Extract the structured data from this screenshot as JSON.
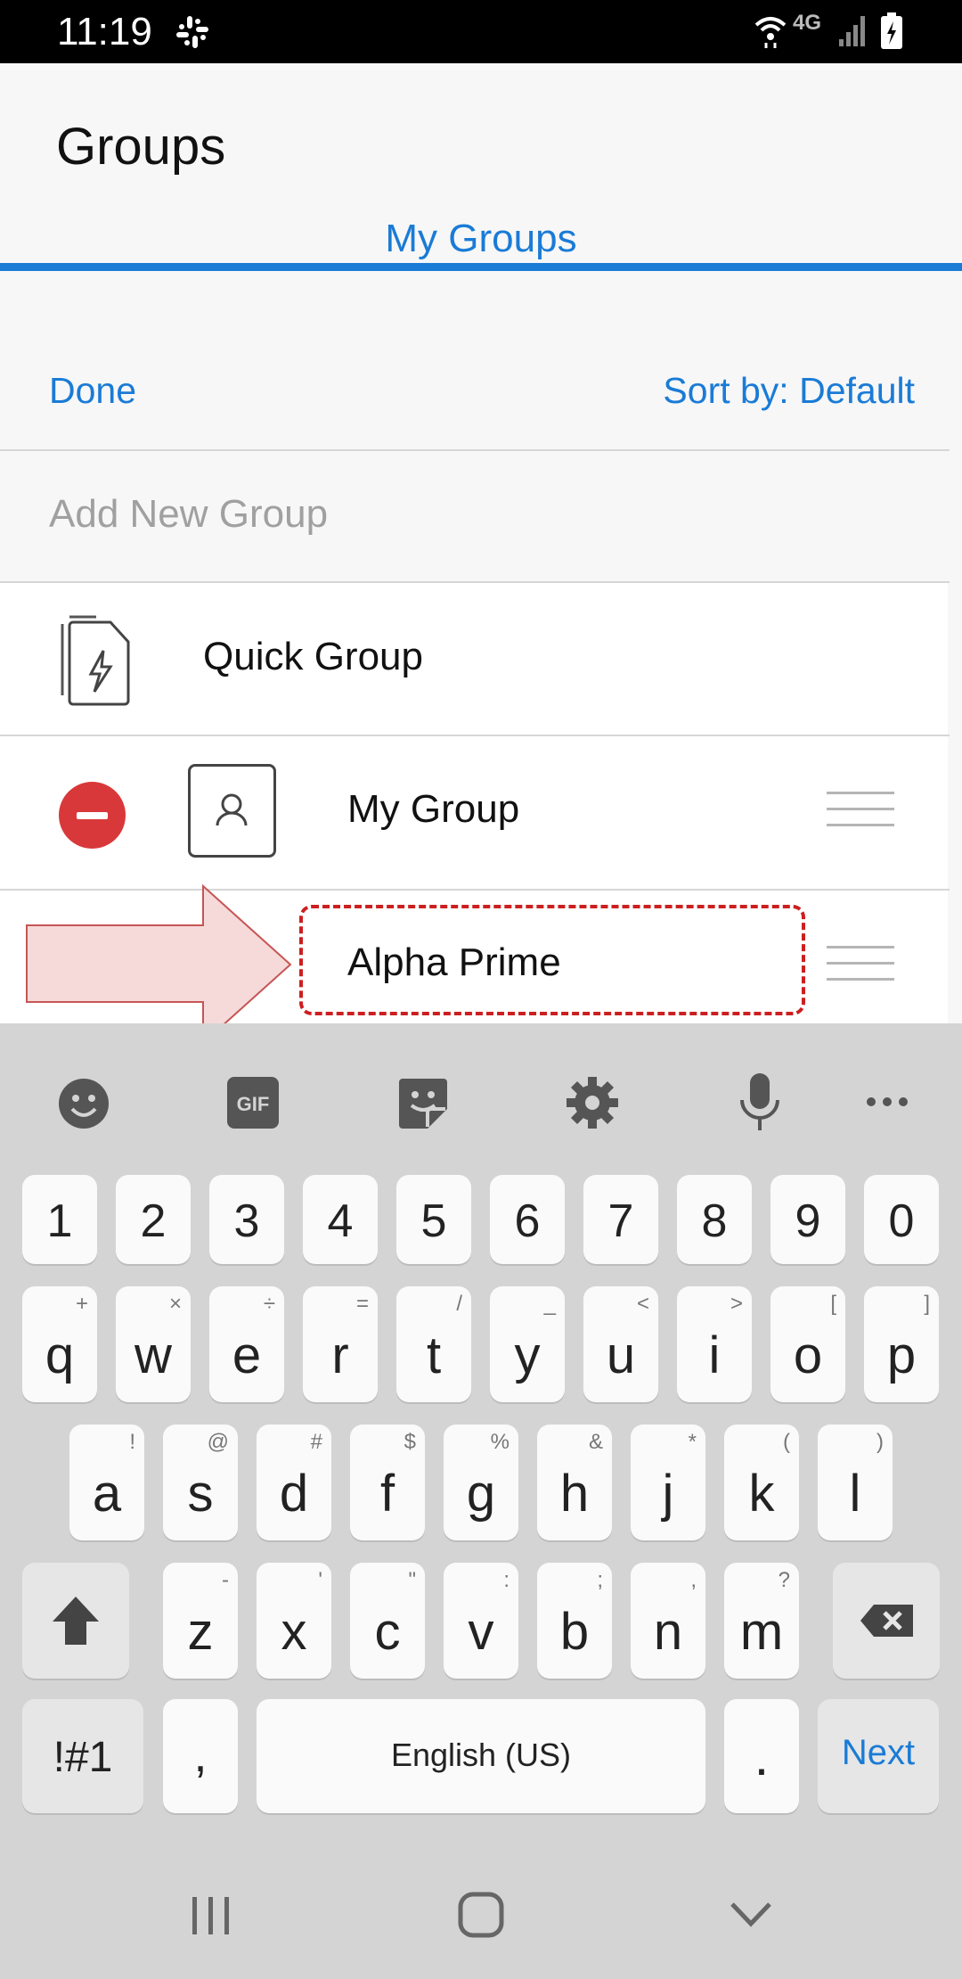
{
  "status_bar": {
    "time": "11:19",
    "network": "4G"
  },
  "header": {
    "title": "Groups",
    "tab": "My Groups"
  },
  "toolbar": {
    "done": "Done",
    "sort": "Sort by: Default"
  },
  "add_new_placeholder": "Add New Group",
  "groups": [
    {
      "name": "Quick Group",
      "icon": "quick-group-icon"
    },
    {
      "name": "My Group",
      "icon": "person-icon"
    }
  ],
  "editing_group": {
    "value": "Alpha Prime"
  },
  "keyboard": {
    "number_row": [
      "1",
      "2",
      "3",
      "4",
      "5",
      "6",
      "7",
      "8",
      "9",
      "0"
    ],
    "row1": [
      {
        "k": "q",
        "s": "+"
      },
      {
        "k": "w",
        "s": "×"
      },
      {
        "k": "e",
        "s": "÷"
      },
      {
        "k": "r",
        "s": "="
      },
      {
        "k": "t",
        "s": "/"
      },
      {
        "k": "y",
        "s": "_"
      },
      {
        "k": "u",
        "s": "<"
      },
      {
        "k": "i",
        "s": ">"
      },
      {
        "k": "o",
        "s": "["
      },
      {
        "k": "p",
        "s": "]"
      }
    ],
    "row2": [
      {
        "k": "a",
        "s": "!"
      },
      {
        "k": "s",
        "s": "@"
      },
      {
        "k": "d",
        "s": "#"
      },
      {
        "k": "f",
        "s": "$"
      },
      {
        "k": "g",
        "s": "%"
      },
      {
        "k": "h",
        "s": "&"
      },
      {
        "k": "j",
        "s": "*"
      },
      {
        "k": "k",
        "s": "("
      },
      {
        "k": "l",
        "s": ")"
      }
    ],
    "row3": [
      {
        "k": "z",
        "s": "-"
      },
      {
        "k": "x",
        "s": "'"
      },
      {
        "k": "c",
        "s": "\""
      },
      {
        "k": "v",
        "s": ":"
      },
      {
        "k": "b",
        "s": ";"
      },
      {
        "k": "n",
        "s": ","
      },
      {
        "k": "m",
        "s": "?"
      }
    ],
    "symbols_key": "!#1",
    "comma_key": ",",
    "space_label": "English (US)",
    "period_key": ".",
    "next_key": "Next"
  }
}
